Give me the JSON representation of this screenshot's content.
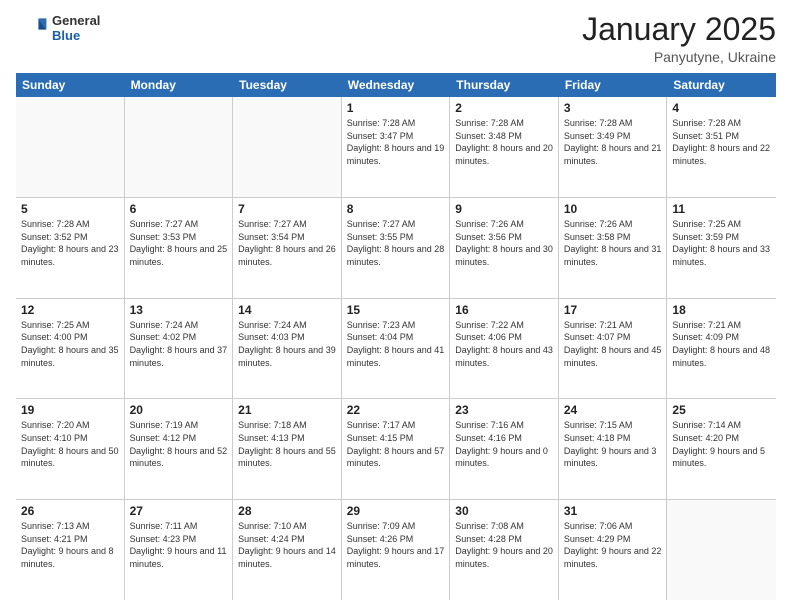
{
  "header": {
    "logo_general": "General",
    "logo_blue": "Blue",
    "month_title": "January 2025",
    "location": "Panyutyne, Ukraine"
  },
  "weekdays": [
    "Sunday",
    "Monday",
    "Tuesday",
    "Wednesday",
    "Thursday",
    "Friday",
    "Saturday"
  ],
  "weeks": [
    [
      {
        "day": "",
        "empty": true
      },
      {
        "day": "",
        "empty": true
      },
      {
        "day": "",
        "empty": true
      },
      {
        "day": "1",
        "sunrise": "7:28 AM",
        "sunset": "3:47 PM",
        "daylight": "8 hours and 19 minutes."
      },
      {
        "day": "2",
        "sunrise": "7:28 AM",
        "sunset": "3:48 PM",
        "daylight": "8 hours and 20 minutes."
      },
      {
        "day": "3",
        "sunrise": "7:28 AM",
        "sunset": "3:49 PM",
        "daylight": "8 hours and 21 minutes."
      },
      {
        "day": "4",
        "sunrise": "7:28 AM",
        "sunset": "3:51 PM",
        "daylight": "8 hours and 22 minutes."
      }
    ],
    [
      {
        "day": "5",
        "sunrise": "7:28 AM",
        "sunset": "3:52 PM",
        "daylight": "8 hours and 23 minutes."
      },
      {
        "day": "6",
        "sunrise": "7:27 AM",
        "sunset": "3:53 PM",
        "daylight": "8 hours and 25 minutes."
      },
      {
        "day": "7",
        "sunrise": "7:27 AM",
        "sunset": "3:54 PM",
        "daylight": "8 hours and 26 minutes."
      },
      {
        "day": "8",
        "sunrise": "7:27 AM",
        "sunset": "3:55 PM",
        "daylight": "8 hours and 28 minutes."
      },
      {
        "day": "9",
        "sunrise": "7:26 AM",
        "sunset": "3:56 PM",
        "daylight": "8 hours and 30 minutes."
      },
      {
        "day": "10",
        "sunrise": "7:26 AM",
        "sunset": "3:58 PM",
        "daylight": "8 hours and 31 minutes."
      },
      {
        "day": "11",
        "sunrise": "7:25 AM",
        "sunset": "3:59 PM",
        "daylight": "8 hours and 33 minutes."
      }
    ],
    [
      {
        "day": "12",
        "sunrise": "7:25 AM",
        "sunset": "4:00 PM",
        "daylight": "8 hours and 35 minutes."
      },
      {
        "day": "13",
        "sunrise": "7:24 AM",
        "sunset": "4:02 PM",
        "daylight": "8 hours and 37 minutes."
      },
      {
        "day": "14",
        "sunrise": "7:24 AM",
        "sunset": "4:03 PM",
        "daylight": "8 hours and 39 minutes."
      },
      {
        "day": "15",
        "sunrise": "7:23 AM",
        "sunset": "4:04 PM",
        "daylight": "8 hours and 41 minutes."
      },
      {
        "day": "16",
        "sunrise": "7:22 AM",
        "sunset": "4:06 PM",
        "daylight": "8 hours and 43 minutes."
      },
      {
        "day": "17",
        "sunrise": "7:21 AM",
        "sunset": "4:07 PM",
        "daylight": "8 hours and 45 minutes."
      },
      {
        "day": "18",
        "sunrise": "7:21 AM",
        "sunset": "4:09 PM",
        "daylight": "8 hours and 48 minutes."
      }
    ],
    [
      {
        "day": "19",
        "sunrise": "7:20 AM",
        "sunset": "4:10 PM",
        "daylight": "8 hours and 50 minutes."
      },
      {
        "day": "20",
        "sunrise": "7:19 AM",
        "sunset": "4:12 PM",
        "daylight": "8 hours and 52 minutes."
      },
      {
        "day": "21",
        "sunrise": "7:18 AM",
        "sunset": "4:13 PM",
        "daylight": "8 hours and 55 minutes."
      },
      {
        "day": "22",
        "sunrise": "7:17 AM",
        "sunset": "4:15 PM",
        "daylight": "8 hours and 57 minutes."
      },
      {
        "day": "23",
        "sunrise": "7:16 AM",
        "sunset": "4:16 PM",
        "daylight": "9 hours and 0 minutes."
      },
      {
        "day": "24",
        "sunrise": "7:15 AM",
        "sunset": "4:18 PM",
        "daylight": "9 hours and 3 minutes."
      },
      {
        "day": "25",
        "sunrise": "7:14 AM",
        "sunset": "4:20 PM",
        "daylight": "9 hours and 5 minutes."
      }
    ],
    [
      {
        "day": "26",
        "sunrise": "7:13 AM",
        "sunset": "4:21 PM",
        "daylight": "9 hours and 8 minutes."
      },
      {
        "day": "27",
        "sunrise": "7:11 AM",
        "sunset": "4:23 PM",
        "daylight": "9 hours and 11 minutes."
      },
      {
        "day": "28",
        "sunrise": "7:10 AM",
        "sunset": "4:24 PM",
        "daylight": "9 hours and 14 minutes."
      },
      {
        "day": "29",
        "sunrise": "7:09 AM",
        "sunset": "4:26 PM",
        "daylight": "9 hours and 17 minutes."
      },
      {
        "day": "30",
        "sunrise": "7:08 AM",
        "sunset": "4:28 PM",
        "daylight": "9 hours and 20 minutes."
      },
      {
        "day": "31",
        "sunrise": "7:06 AM",
        "sunset": "4:29 PM",
        "daylight": "9 hours and 22 minutes."
      },
      {
        "day": "",
        "empty": true
      }
    ]
  ]
}
